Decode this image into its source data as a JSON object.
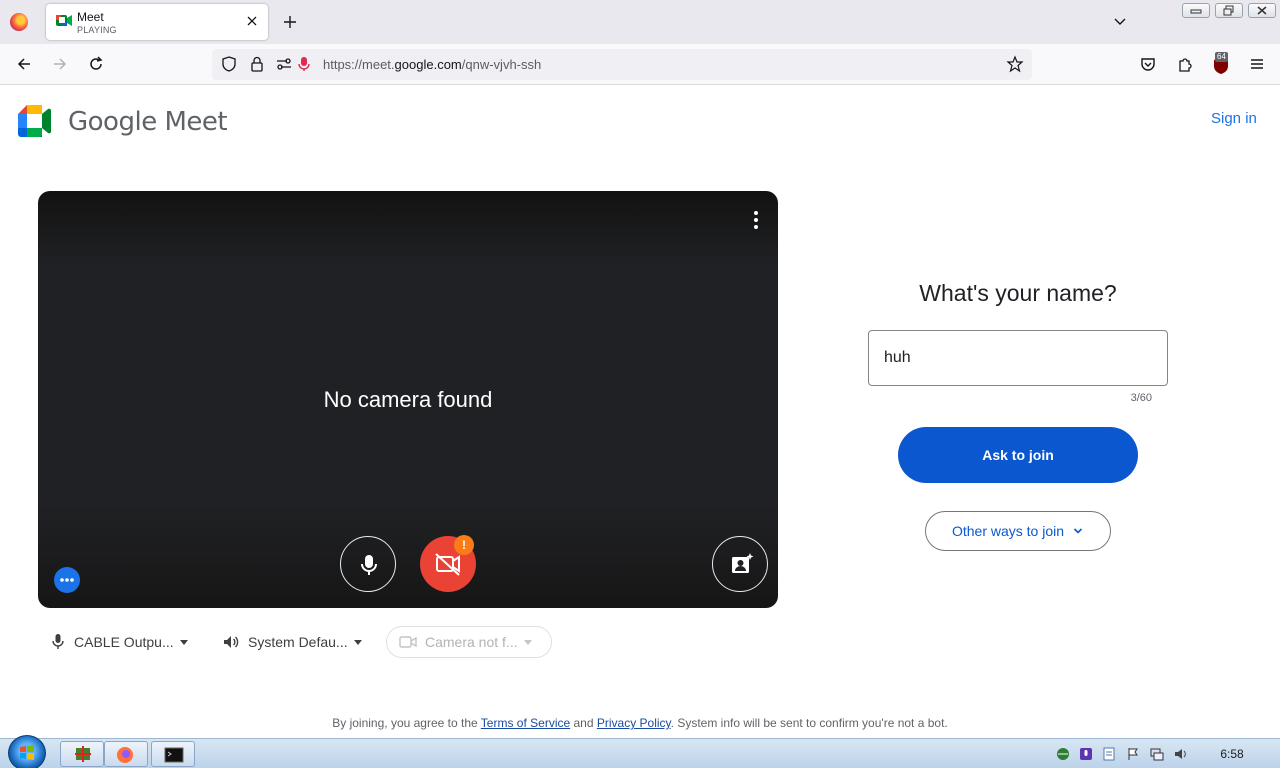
{
  "browser": {
    "tab": {
      "title": "Meet",
      "subtitle": "PLAYING"
    },
    "url": {
      "prefix": "https://meet.",
      "domain": "google.com",
      "path": "/qnw-vjvh-ssh"
    },
    "extension_badge": "64"
  },
  "header": {
    "wordmark": "Google Meet",
    "sign_in": "Sign in"
  },
  "preview": {
    "message": "No camera found",
    "warning_mark": "!"
  },
  "devices": {
    "microphone": "CABLE Outpu...",
    "speaker": "System Defau...",
    "camera": "Camera not f..."
  },
  "join": {
    "heading": "What's your name?",
    "name_value": "huh",
    "char_count": "3/60",
    "ask_button": "Ask to join",
    "other_ways": "Other ways to join"
  },
  "footer": {
    "before": "By joining, you agree to the ",
    "terms": "Terms of Service",
    "and": " and ",
    "privacy": "Privacy Policy",
    "after": ". System info will be sent to confirm you're not a bot."
  },
  "taskbar": {
    "clock": "6:58"
  },
  "colors": {
    "primary": "#0b57d0",
    "link": "#1a73e8",
    "cam_off": "#ea4335",
    "warning": "#fa7b17"
  }
}
